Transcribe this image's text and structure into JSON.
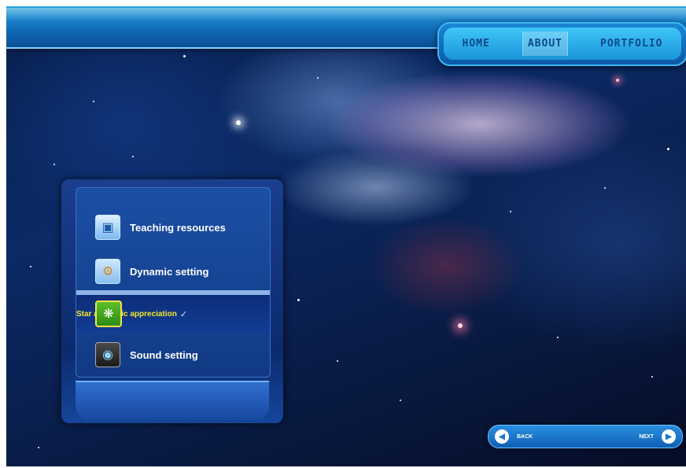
{
  "nav": {
    "items": [
      {
        "label": "HOME",
        "active": false
      },
      {
        "label": "ABOUT",
        "active": true
      },
      {
        "label": "PORTFOLIO",
        "active": false
      }
    ]
  },
  "menu": {
    "items": [
      {
        "label": "Teaching resources",
        "icon": "teaching-resources-icon"
      },
      {
        "label": "Dynamic setting",
        "icon": "dynamic-setting-icon"
      },
      {
        "label": "Star aesthetic appreciation",
        "icon": "star-aesthetic-icon",
        "selected": true,
        "check": "✓"
      },
      {
        "label": "Sound setting",
        "icon": "sound-setting-icon"
      }
    ]
  },
  "pager": {
    "back_label": "BACK",
    "next_label": "NEXT",
    "back_icon": "back-arrow-icon",
    "next_icon": "next-arrow-icon"
  },
  "colors": {
    "topbar": "#0f6db8",
    "nav_text": "#0b4a8c",
    "selected_text": "#f2e82a",
    "menu_bg": "#123a84"
  }
}
